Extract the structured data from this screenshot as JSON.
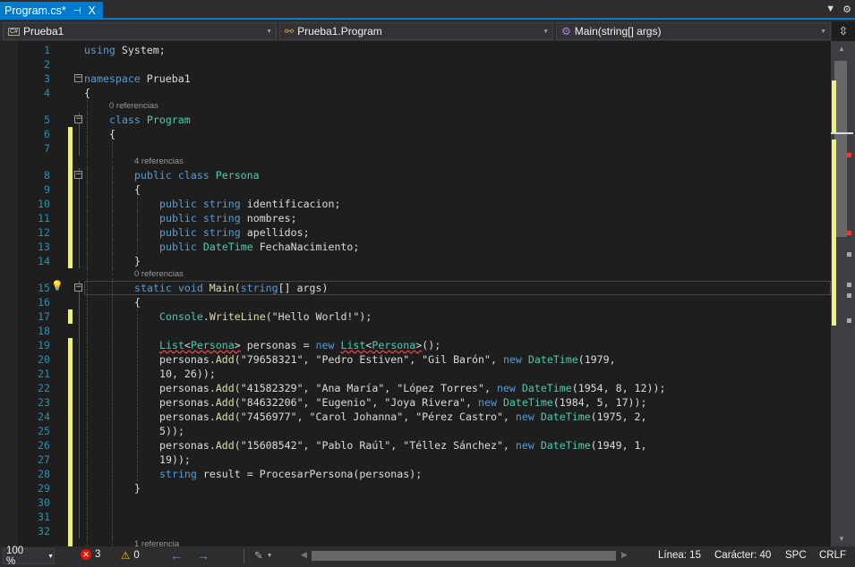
{
  "tab": {
    "title": "Program.cs*",
    "pin_icon": "pin-icon",
    "close": "X"
  },
  "nav": {
    "project": "Prueba1",
    "class": "Prueba1.Program",
    "member": "Main(string[] args)"
  },
  "rows": [
    {
      "n": "1",
      "i": 0,
      "c": [
        [
          "using",
          "k"
        ],
        [
          " System;",
          "p"
        ]
      ]
    },
    {
      "n": "2",
      "i": 0,
      "c": []
    },
    {
      "n": "3",
      "i": 0,
      "fold": true,
      "c": [
        [
          "namespace",
          "k"
        ],
        [
          " Prueba1",
          "p"
        ]
      ]
    },
    {
      "n": "4",
      "i": 0,
      "c": [
        [
          "{",
          "p"
        ]
      ]
    },
    {
      "lens": "0 referencias",
      "i": 1
    },
    {
      "n": "5",
      "i": 1,
      "fold": true,
      "c": [
        [
          "class",
          "k"
        ],
        [
          " ",
          "p"
        ],
        [
          "Program",
          "t"
        ]
      ]
    },
    {
      "n": "6",
      "i": 1,
      "mod": true,
      "c": [
        [
          "{",
          "p"
        ]
      ]
    },
    {
      "n": "7",
      "i": 2,
      "mod": true,
      "c": []
    },
    {
      "lens": "4 referencias",
      "i": 2,
      "mod": true
    },
    {
      "n": "8",
      "i": 2,
      "fold": true,
      "mod": true,
      "c": [
        [
          "public",
          "k"
        ],
        [
          " ",
          "p"
        ],
        [
          "class",
          "k"
        ],
        [
          " ",
          "p"
        ],
        [
          "Persona",
          "t"
        ]
      ]
    },
    {
      "n": "9",
      "i": 2,
      "mod": true,
      "c": [
        [
          "{",
          "p"
        ]
      ]
    },
    {
      "n": "10",
      "i": 3,
      "mod": true,
      "c": [
        [
          "public",
          "k"
        ],
        [
          " ",
          "p"
        ],
        [
          "string",
          "k"
        ],
        [
          " identificacion;",
          "p"
        ]
      ]
    },
    {
      "n": "11",
      "i": 3,
      "mod": true,
      "c": [
        [
          "public",
          "k"
        ],
        [
          " ",
          "p"
        ],
        [
          "string",
          "k"
        ],
        [
          " nombres;",
          "p"
        ]
      ]
    },
    {
      "n": "12",
      "i": 3,
      "mod": true,
      "c": [
        [
          "public",
          "k"
        ],
        [
          " ",
          "p"
        ],
        [
          "string",
          "k"
        ],
        [
          " apellidos;",
          "p"
        ]
      ]
    },
    {
      "n": "13",
      "i": 3,
      "mod": true,
      "c": [
        [
          "public",
          "k"
        ],
        [
          " ",
          "p"
        ],
        [
          "DateTime",
          "t"
        ],
        [
          " FechaNacimiento;",
          "p"
        ]
      ]
    },
    {
      "n": "14",
      "i": 2,
      "mod": true,
      "c": [
        [
          "}",
          "p"
        ]
      ]
    },
    {
      "lens": "0 referencias",
      "i": 2
    },
    {
      "n": "15",
      "i": 2,
      "fold": true,
      "cur": true,
      "bulb": true,
      "c": [
        [
          "static",
          "k"
        ],
        [
          " ",
          "p"
        ],
        [
          "void",
          "k"
        ],
        [
          " ",
          "p"
        ],
        [
          "Main",
          "m"
        ],
        [
          "(",
          "p"
        ],
        [
          "string",
          "k"
        ],
        [
          "[] args)",
          "p"
        ]
      ]
    },
    {
      "n": "16",
      "i": 2,
      "c": [
        [
          "{",
          "p"
        ]
      ]
    },
    {
      "n": "17",
      "i": 3,
      "mod": true,
      "c": [
        [
          "Console",
          "t"
        ],
        [
          ".",
          "p"
        ],
        [
          "WriteLine",
          "m"
        ],
        [
          "(\"Hello World!\");",
          "p"
        ]
      ]
    },
    {
      "n": "18",
      "i": 3,
      "c": []
    },
    {
      "n": "19",
      "i": 3,
      "mod": true,
      "c": [
        [
          "List",
          "t",
          "err"
        ],
        [
          "<",
          "p",
          "err"
        ],
        [
          "Persona",
          "t",
          "err"
        ],
        [
          ">",
          "p",
          "err"
        ],
        [
          " personas = ",
          "p"
        ],
        [
          "new",
          "k"
        ],
        [
          " ",
          "p"
        ],
        [
          "List",
          "t",
          "err"
        ],
        [
          "<",
          "p",
          "err"
        ],
        [
          "Persona",
          "t",
          "err"
        ],
        [
          ">",
          "p",
          "err"
        ],
        [
          "();",
          "p"
        ]
      ]
    },
    {
      "n": "20",
      "i": 3,
      "mod": true,
      "c": [
        [
          "personas.",
          "p"
        ],
        [
          "Add",
          "m"
        ],
        [
          "(\"79658321\", \"Pedro Estiven\", \"Gil Barón\", ",
          "p"
        ],
        [
          "new",
          "k"
        ],
        [
          " ",
          "p"
        ],
        [
          "DateTime",
          "t"
        ],
        [
          "(1979,",
          "p"
        ]
      ]
    },
    {
      "n": "21",
      "i": 3,
      "mod": true,
      "c": [
        [
          "10, 26));",
          "p"
        ]
      ]
    },
    {
      "n": "22",
      "i": 3,
      "mod": true,
      "c": [
        [
          "personas.",
          "p"
        ],
        [
          "Add",
          "m"
        ],
        [
          "(\"41582329\", \"Ana María\", \"López Torres\", ",
          "p"
        ],
        [
          "new",
          "k"
        ],
        [
          " ",
          "p"
        ],
        [
          "DateTime",
          "t"
        ],
        [
          "(1954, 8, 12));",
          "p"
        ]
      ]
    },
    {
      "n": "23",
      "i": 3,
      "mod": true,
      "c": [
        [
          "personas.",
          "p"
        ],
        [
          "Add",
          "m"
        ],
        [
          "(\"84632206\", \"Eugenio\", \"Joya Rivera\", ",
          "p"
        ],
        [
          "new",
          "k"
        ],
        [
          " ",
          "p"
        ],
        [
          "DateTime",
          "t"
        ],
        [
          "(1984, 5, 17));",
          "p"
        ]
      ]
    },
    {
      "n": "24",
      "i": 3,
      "mod": true,
      "c": [
        [
          "personas.",
          "p"
        ],
        [
          "Add",
          "m"
        ],
        [
          "(\"7456977\", \"Carol Johanna\", \"Pérez Castro\", ",
          "p"
        ],
        [
          "new",
          "k"
        ],
        [
          " ",
          "p"
        ],
        [
          "DateTime",
          "t"
        ],
        [
          "(1975, 2,",
          "p"
        ]
      ]
    },
    {
      "n": "25",
      "i": 3,
      "mod": true,
      "c": [
        [
          "5));",
          "p"
        ]
      ]
    },
    {
      "n": "26",
      "i": 3,
      "mod": true,
      "c": [
        [
          "personas.",
          "p"
        ],
        [
          "Add",
          "m"
        ],
        [
          "(\"15608542\", \"Pablo Raúl\", \"Téllez Sánchez\", ",
          "p"
        ],
        [
          "new",
          "k"
        ],
        [
          " ",
          "p"
        ],
        [
          "DateTime",
          "t"
        ],
        [
          "(1949, 1,",
          "p"
        ]
      ]
    },
    {
      "n": "27",
      "i": 3,
      "mod": true,
      "c": [
        [
          "19));",
          "p"
        ]
      ]
    },
    {
      "n": "28",
      "i": 3,
      "mod": true,
      "c": [
        [
          "string",
          "k"
        ],
        [
          " result = ",
          "p"
        ],
        [
          "ProcesarPersona",
          "p"
        ],
        [
          "(personas);",
          "p"
        ]
      ]
    },
    {
      "n": "29",
      "i": 2,
      "mod": true,
      "c": [
        [
          "}",
          "p"
        ]
      ]
    },
    {
      "n": "30",
      "i": 2,
      "mod": true,
      "c": []
    },
    {
      "n": "31",
      "i": 2,
      "mod": true,
      "c": []
    },
    {
      "n": "32",
      "i": 2,
      "mod": true,
      "c": []
    },
    {
      "lens": "1 referencia",
      "i": 2,
      "mod": true
    }
  ],
  "status": {
    "zoom": "100 %",
    "errors": "3",
    "warnings": "0",
    "line": "Línea: 15",
    "char": "Carácter: 40",
    "spc": "SPC",
    "crlf": "CRLF"
  },
  "colors": {
    "accent": "#007acc",
    "modified": "#eff07f",
    "error": "#f14c4c"
  }
}
